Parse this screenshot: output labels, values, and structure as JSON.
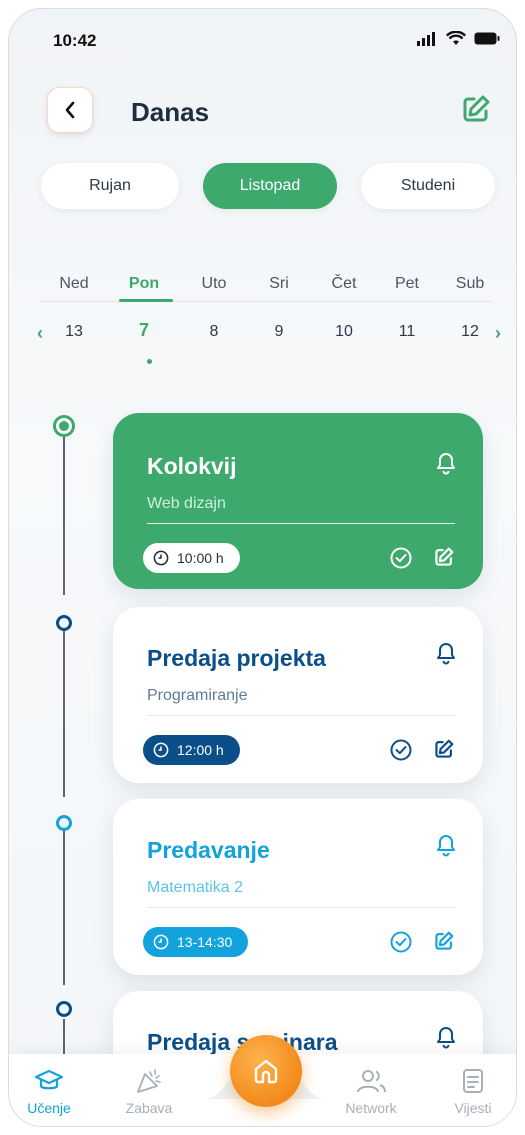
{
  "status": {
    "time": "10:42"
  },
  "header": {
    "title": "Danas"
  },
  "months": [
    "Rujan",
    "Listopad",
    "Studeni"
  ],
  "week": {
    "days": [
      "Ned",
      "Pon",
      "Uto",
      "Sri",
      "Čet",
      "Pet",
      "Sub"
    ],
    "dates": [
      "13",
      "7",
      "8",
      "9",
      "10",
      "11",
      "12"
    ],
    "active_index": 1
  },
  "events": [
    {
      "title": "Kolokvij",
      "subject": "Web dizajn",
      "time": "10:00 h",
      "style": "green"
    },
    {
      "title": "Predaja projekta",
      "subject": "Programiranje",
      "time": "12:00 h",
      "style": "navy"
    },
    {
      "title": "Predavanje",
      "subject": "Matematika 2",
      "time": "13-14:30",
      "style": "cyan"
    },
    {
      "title": "Predaja seminara",
      "subject": "",
      "time": "",
      "style": "navy"
    }
  ],
  "nav": {
    "items": [
      {
        "label": "Učenje",
        "icon": "graduation-cap-icon",
        "active": true
      },
      {
        "label": "Zabava",
        "icon": "party-popper-icon",
        "active": false
      },
      {
        "label": "Network",
        "icon": "users-icon",
        "active": false
      },
      {
        "label": "Vijesti",
        "icon": "document-icon",
        "active": false
      }
    ],
    "home_icon": "home-icon"
  },
  "colors": {
    "green": "#3ea96c",
    "navy": "#0b4f8a",
    "cyan": "#12a2dc",
    "orange": "#f28a1b"
  }
}
